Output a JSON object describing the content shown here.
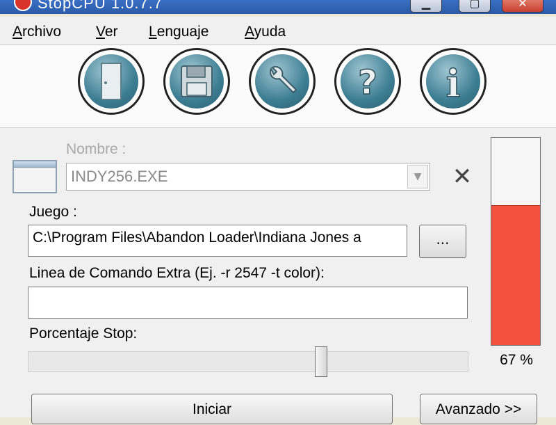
{
  "window": {
    "title": "StopCPU 1.0.7.7"
  },
  "menu": [
    {
      "label": "Archivo"
    },
    {
      "label": "Ver"
    },
    {
      "label": "Lenguaje"
    },
    {
      "label": "Ayuda"
    }
  ],
  "toolbar": {
    "buttons": [
      {
        "icon": "door-icon"
      },
      {
        "icon": "floppy-disk-icon"
      },
      {
        "icon": "wrench-icon"
      },
      {
        "icon": "help-icon"
      },
      {
        "icon": "info-icon"
      }
    ]
  },
  "form": {
    "nombre_label": "Nombre :",
    "nombre_value": "INDY256.EXE",
    "juego_label": "Juego :",
    "juego_value": "C:\\Program Files\\Abandon Loader\\Indiana Jones a",
    "browse_label": "...",
    "extra_label": "Linea de Comando Extra (Ej. -r 2547 -t color):",
    "extra_value": "",
    "stop_label": "Porcentaje Stop:",
    "stop_value": 67
  },
  "meter": {
    "value": 67,
    "label": "67 %",
    "color": "#f4523e"
  },
  "buttons": {
    "start": "Iniciar",
    "advanced": "Avanzado >>"
  }
}
